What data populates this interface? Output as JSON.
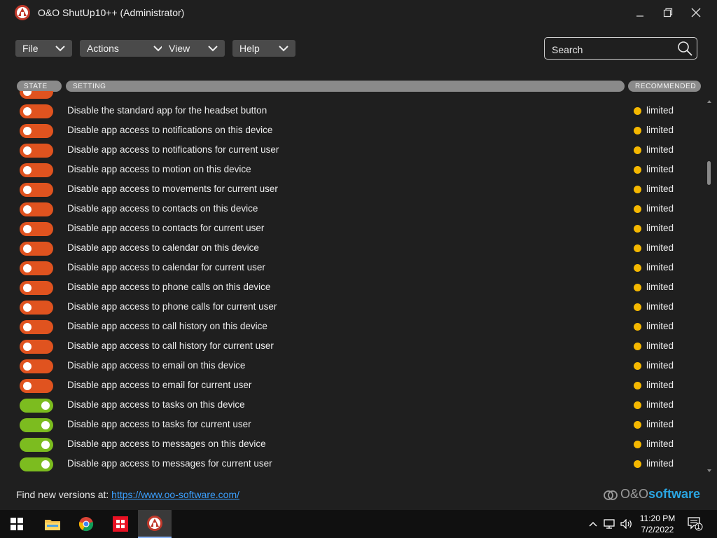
{
  "window": {
    "title": "O&O ShutUp10++ (Administrator)"
  },
  "menu": [
    {
      "label": "File"
    },
    {
      "label": "Actions"
    },
    {
      "label": "View"
    },
    {
      "label": "Help"
    }
  ],
  "search": {
    "placeholder": "Search"
  },
  "columns": {
    "state": "STATE",
    "setting": "SETTING",
    "recommended": "RECOMMENDED"
  },
  "settings": [
    {
      "label": "Disable the standard app for the headset button",
      "state": "off",
      "recommended": "limited"
    },
    {
      "label": "Disable app access to notifications on this device",
      "state": "off",
      "recommended": "limited"
    },
    {
      "label": "Disable app access to notifications for current user",
      "state": "off",
      "recommended": "limited"
    },
    {
      "label": "Disable app access to motion on this device",
      "state": "off",
      "recommended": "limited"
    },
    {
      "label": "Disable app access to movements for current user",
      "state": "off",
      "recommended": "limited"
    },
    {
      "label": "Disable app access to contacts on this device",
      "state": "off",
      "recommended": "limited"
    },
    {
      "label": "Disable app access to contacts for current user",
      "state": "off",
      "recommended": "limited"
    },
    {
      "label": "Disable app access to calendar on this device",
      "state": "off",
      "recommended": "limited"
    },
    {
      "label": "Disable app access to calendar for current user",
      "state": "off",
      "recommended": "limited"
    },
    {
      "label": "Disable app access to phone calls on this device",
      "state": "off",
      "recommended": "limited"
    },
    {
      "label": "Disable app access to phone calls for current user",
      "state": "off",
      "recommended": "limited"
    },
    {
      "label": "Disable app access to call history on this device",
      "state": "off",
      "recommended": "limited"
    },
    {
      "label": "Disable app access to call history for current user",
      "state": "off",
      "recommended": "limited"
    },
    {
      "label": "Disable app access to email on this device",
      "state": "off",
      "recommended": "limited"
    },
    {
      "label": "Disable app access to email for current user",
      "state": "off",
      "recommended": "limited"
    },
    {
      "label": "Disable app access to tasks on this device",
      "state": "on",
      "recommended": "limited"
    },
    {
      "label": "Disable app access to tasks for current user",
      "state": "on",
      "recommended": "limited"
    },
    {
      "label": "Disable app access to messages on this device",
      "state": "on",
      "recommended": "limited"
    },
    {
      "label": "Disable app access to messages for current user",
      "state": "on",
      "recommended": "limited"
    }
  ],
  "footer": {
    "text": "Find new versions at: ",
    "link": "https://www.oo-software.com/",
    "brand_prefix": "O&O",
    "brand_suffix": "software"
  },
  "taskbar": {
    "time": "11:20 PM",
    "date": "7/2/2022",
    "notification_count": "1"
  },
  "colors": {
    "toggle_off": "#e0531f",
    "toggle_on": "#7cbc1f",
    "recommended_dot": "#f5b800",
    "link": "#3ba0ff",
    "brand": "#2aa4e0"
  }
}
